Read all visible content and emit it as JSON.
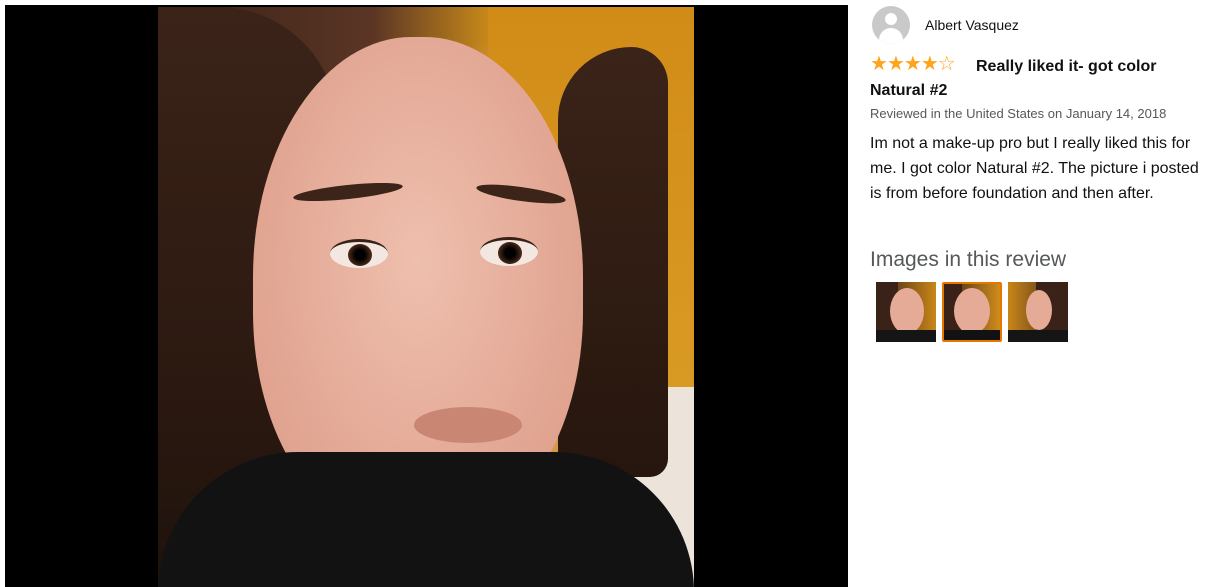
{
  "review": {
    "reviewer_name": "Albert Vasquez",
    "rating": 4,
    "rating_max": 5,
    "title": "Really liked it- got color Natural #2",
    "meta": "Reviewed in the United States on January 14, 2018",
    "body": "Im not a make-up pro but I really liked this for me. I got color Natural #2. The picture i posted is from before foundation and then after.",
    "images_heading": "Images in this review",
    "thumbnail_count": 3,
    "selected_thumbnail": 2
  },
  "colors": {
    "star": "#ffa41c",
    "selected_border": "#e77600",
    "meta_text": "#565959"
  },
  "icons": {
    "avatar": "default-user-avatar-icon",
    "star_full": "star-filled-icon",
    "star_empty": "star-outline-icon"
  }
}
